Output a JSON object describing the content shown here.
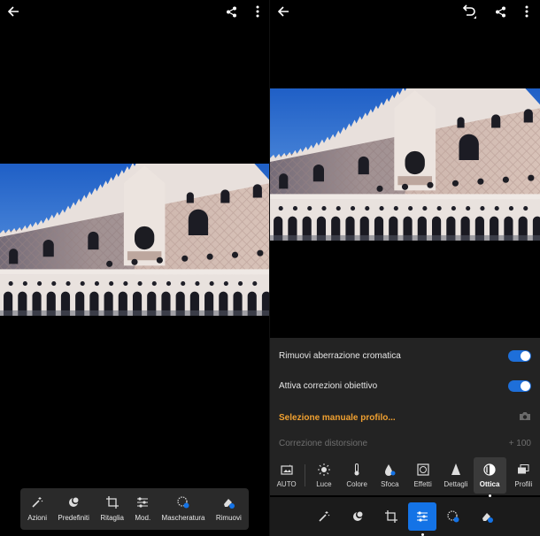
{
  "left_screen": {
    "topbar": {
      "back_icon": "arrow-left-icon",
      "share_icon": "share-icon",
      "more_icon": "more-vertical-icon"
    },
    "toolbar": [
      {
        "label": "Azioni",
        "icon": "magic-wand-icon"
      },
      {
        "label": "Predefiniti",
        "icon": "presets-icon"
      },
      {
        "label": "Ritaglia",
        "icon": "crop-icon"
      },
      {
        "label": "Mod.",
        "icon": "sliders-icon"
      },
      {
        "label": "Mascheratura",
        "icon": "masking-icon"
      },
      {
        "label": "Rimuovi",
        "icon": "eraser-icon"
      }
    ]
  },
  "right_screen": {
    "topbar": {
      "back_icon": "arrow-left-icon",
      "undo_icon": "undo-icon",
      "share_icon": "share-icon",
      "more_icon": "more-vertical-icon"
    },
    "optics": {
      "chromatic_label": "Rimuovi aberrazione cromatica",
      "chromatic_on": true,
      "lens_label": "Attiva correzioni obiettivo",
      "lens_on": true,
      "profile_label": "Selezione manuale profilo...",
      "distortion_label": "Correzione distorsione",
      "distortion_value": "+ 100"
    },
    "subtabs": [
      {
        "label": "AUTO",
        "icon": "auto-icon"
      },
      {
        "label": "Luce",
        "icon": "sun-icon"
      },
      {
        "label": "Colore",
        "icon": "thermometer-icon"
      },
      {
        "label": "Sfoca",
        "icon": "blur-drop-icon"
      },
      {
        "label": "Effetti",
        "icon": "vignette-icon"
      },
      {
        "label": "Dettagli",
        "icon": "triangle-icon"
      },
      {
        "label": "Ottica",
        "icon": "lens-icon"
      },
      {
        "label": "Profili",
        "icon": "profiles-icon"
      }
    ],
    "active_subtab": "Ottica",
    "mainbar_icons": [
      "magic-wand-icon",
      "presets-icon",
      "crop-icon",
      "sliders-icon",
      "masking-icon",
      "eraser-icon"
    ],
    "active_main": "sliders-icon"
  },
  "colors": {
    "accent": "#1473e6",
    "profile_text": "#f0a030",
    "panel_bg": "#232323",
    "toolbar_bg": "#2a2a2a"
  }
}
